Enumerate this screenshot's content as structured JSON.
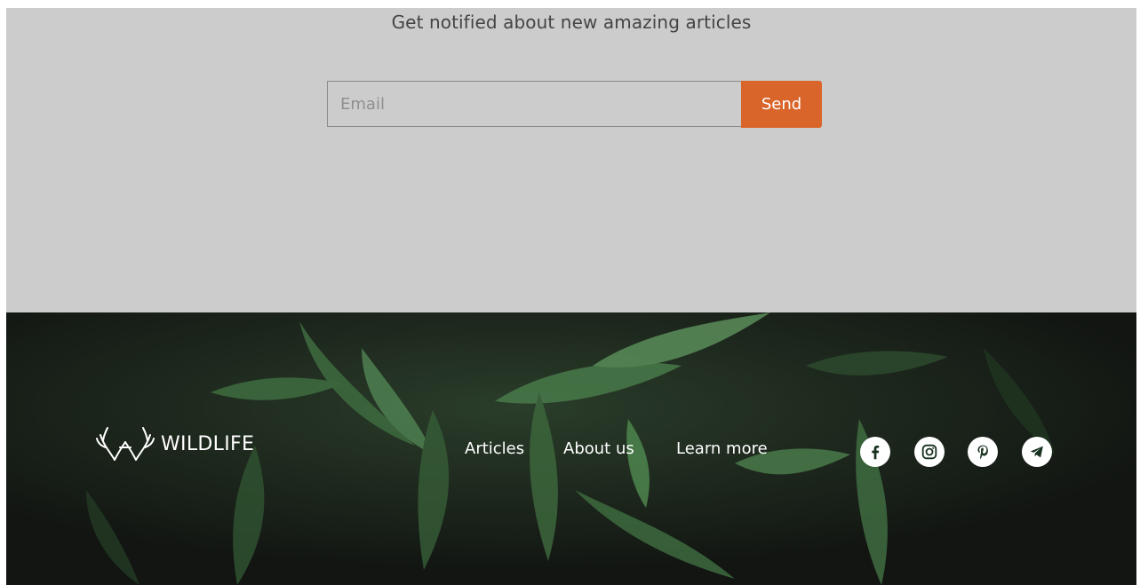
{
  "newsletter": {
    "title": "Get notified about new amazing articles",
    "email_placeholder": "Email",
    "send_label": "Send"
  },
  "footer": {
    "brand_name": "WILDLIFE",
    "nav": [
      {
        "label": "Articles"
      },
      {
        "label": "About us"
      },
      {
        "label": "Learn more"
      }
    ],
    "social": [
      {
        "icon": "facebook-icon"
      },
      {
        "icon": "instagram-icon"
      },
      {
        "icon": "pinterest-icon"
      },
      {
        "icon": "telegram-icon"
      }
    ]
  },
  "colors": {
    "newsletter_bg": "#cccccc",
    "accent": "#d9652a",
    "footer_bg": "#151915",
    "icon_fg": "#17311f"
  }
}
